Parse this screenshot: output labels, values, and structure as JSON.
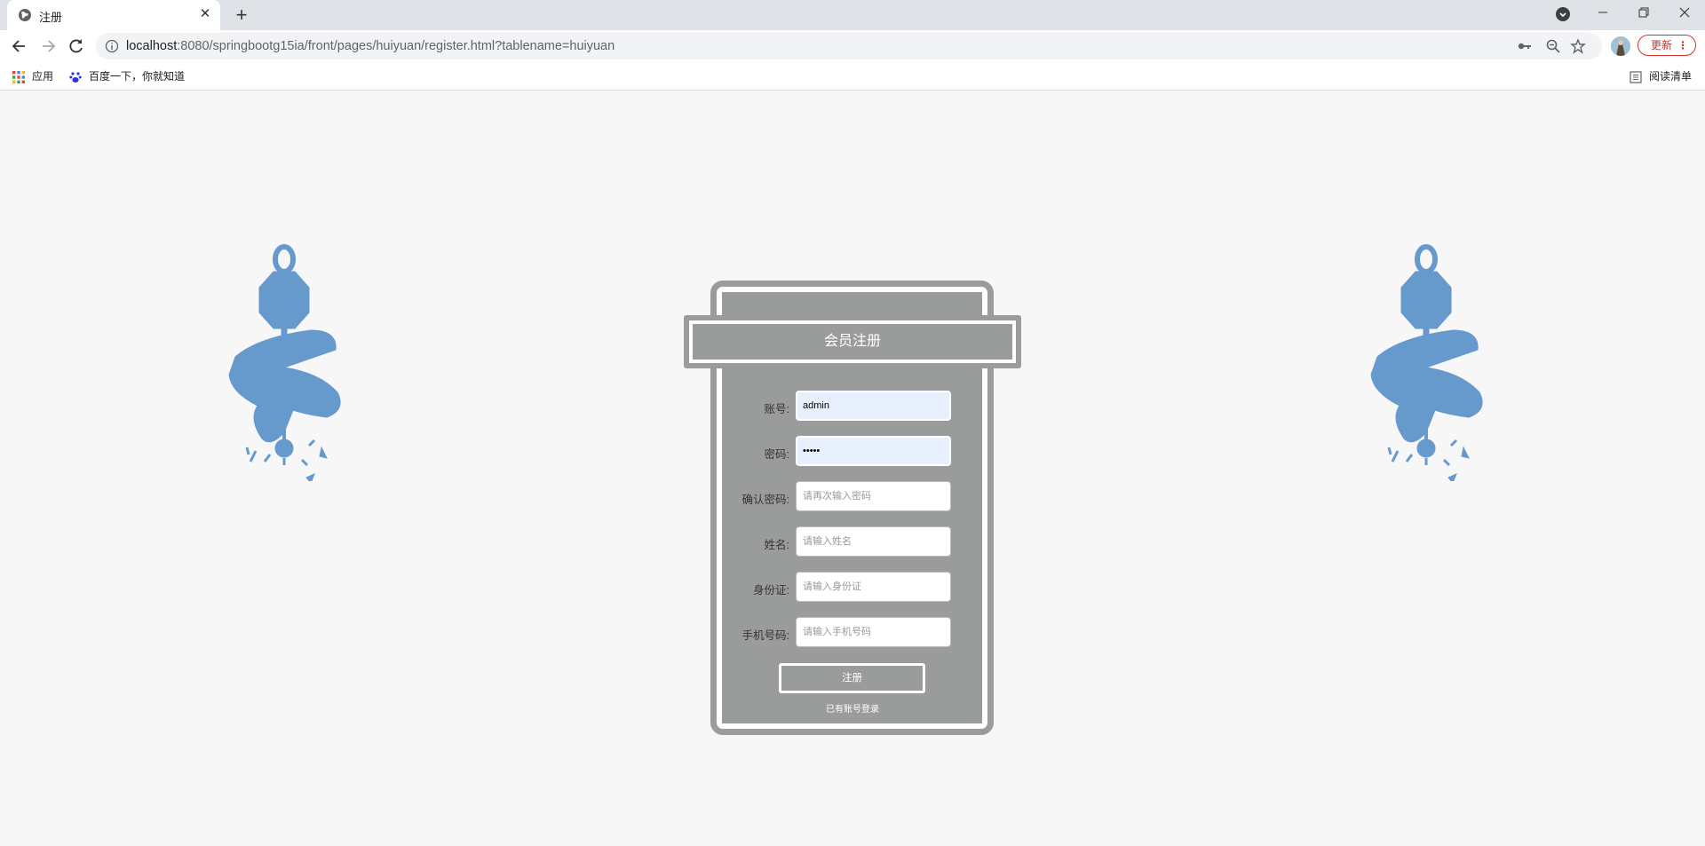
{
  "browser": {
    "tab_title": "注册",
    "url_host": "localhost",
    "url_rest": ":8080/springbootg15ia/front/pages/huiyuan/register.html?tablename=huiyuan",
    "update_label": "更新",
    "bookmarks": [
      "应用",
      "百度一下，你就知道"
    ],
    "reading_list": "阅读清单"
  },
  "form": {
    "title": "会员注册",
    "fields": [
      {
        "label": "账号:",
        "value": "admin",
        "placeholder": ""
      },
      {
        "label": "密码:",
        "value": "•••••",
        "placeholder": ""
      },
      {
        "label": "确认密码:",
        "value": "",
        "placeholder": "请再次输入密码"
      },
      {
        "label": "姓名:",
        "value": "",
        "placeholder": "请输入姓名"
      },
      {
        "label": "身份证:",
        "value": "",
        "placeholder": "请输入身份证"
      },
      {
        "label": "手机号码:",
        "value": "",
        "placeholder": "请输入手机号码"
      }
    ],
    "submit_label": "注册",
    "login_link": "已有账号登录"
  },
  "colors": {
    "panel": "#9a9c9b",
    "lantern": "#6699cc",
    "page_bg": "#f7f7f7"
  }
}
